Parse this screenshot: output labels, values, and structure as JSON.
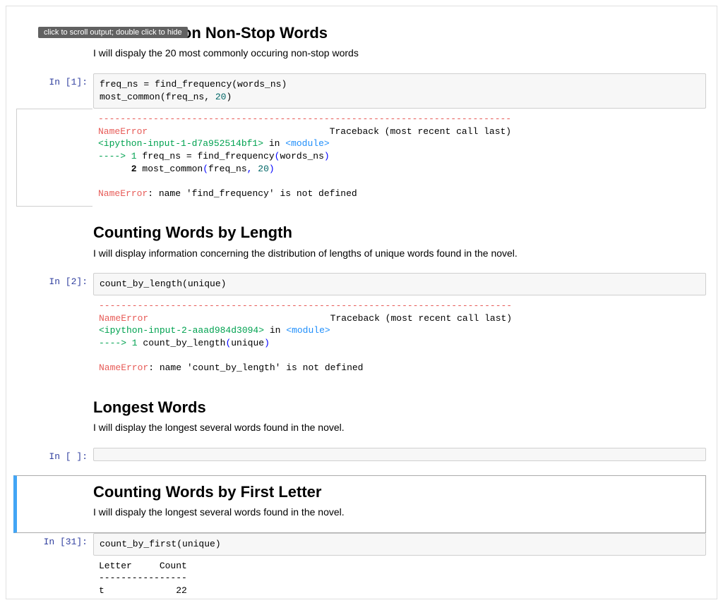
{
  "tooltip": "click to scroll output; double click to hide",
  "cells": {
    "md1": {
      "heading": "Most Common Non-Stop Words",
      "text": "I will dispaly the 20 most commonly occuring non-stop words"
    },
    "code1": {
      "prompt": "In [1]:",
      "line1_a": "freq_ns ",
      "line1_op": "=",
      "line1_b": " find_frequency(words_ns)",
      "line2_a": "most_common(freq_ns, ",
      "line2_num": "20",
      "line2_b": ")"
    },
    "err1": {
      "dash": "---------------------------------------------------------------------------",
      "name": "NameError",
      "trace": "                                 Traceback (most recent call last)",
      "loc_a": "<ipython-input-1-d7a952514bf1>",
      "loc_in": " in ",
      "loc_mod": "<module>",
      "arrow": "----> 1",
      "l1_a": " freq_ns ",
      "l1_op": "=",
      "l1_b": " find_frequency",
      "l1_p1": "(",
      "l1_c": "words_ns",
      "l1_p2": ")",
      "n2": "      2",
      "l2_a": " most_common",
      "l2_p1": "(",
      "l2_b": "freq_ns",
      "l2_comma": ",",
      "l2_sp": " ",
      "l2_num": "20",
      "l2_p2": ")",
      "final_a": "NameError",
      "final_b": ": name 'find_frequency' is not defined"
    },
    "md2": {
      "heading": "Counting Words by Length",
      "text": "I will display information concerning the distribution of lengths of unique words found in the novel."
    },
    "code2": {
      "prompt": "In [2]:",
      "line": "count_by_length(unique)"
    },
    "err2": {
      "dash": "---------------------------------------------------------------------------",
      "name": "NameError",
      "trace": "                                 Traceback (most recent call last)",
      "loc_a": "<ipython-input-2-aaad984d3094>",
      "loc_in": " in ",
      "loc_mod": "<module>",
      "arrow": "----> 1",
      "l1_a": " count_by_length",
      "l1_p1": "(",
      "l1_b": "unique",
      "l1_p2": ")",
      "final_a": "NameError",
      "final_b": ": name 'count_by_length' is not defined"
    },
    "md3": {
      "heading": "Longest Words",
      "text": "I will display the longest several words found in the novel."
    },
    "code3": {
      "prompt": "In [ ]:"
    },
    "md4": {
      "heading": "Counting Words by First Letter",
      "text": "I will dispaly the longest several words found in the novel."
    },
    "code4": {
      "prompt": "In [31]:",
      "line": "count_by_first(unique)"
    },
    "out4": {
      "l1": "Letter     Count",
      "l2": "----------------",
      "l3": "t             22"
    }
  }
}
